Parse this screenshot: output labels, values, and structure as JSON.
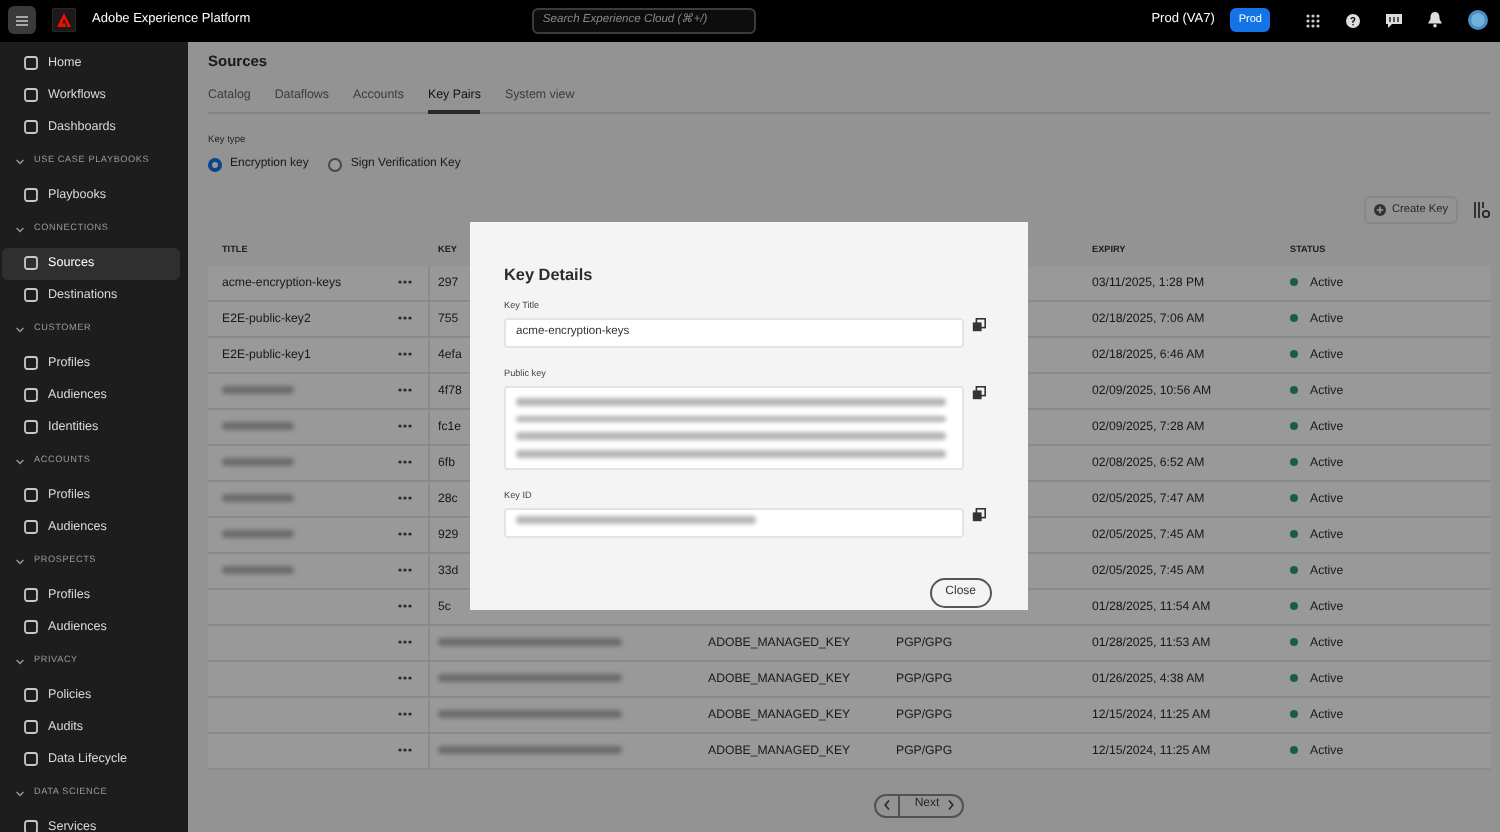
{
  "header": {
    "app_title": "Adobe Experience Platform",
    "search_placeholder": "Search Experience Cloud (⌘+/)",
    "org": "Prod (VA7)",
    "sandbox": "Prod"
  },
  "sidebar": {
    "items": [
      {
        "label": "Home",
        "selected": false
      },
      {
        "label": "Workflows",
        "selected": false
      },
      {
        "label": "Dashboards",
        "selected": false
      }
    ],
    "sections": [
      {
        "title": "USE CASE PLAYBOOKS",
        "expanded": true,
        "items": [
          {
            "label": "Playbooks",
            "selected": false
          }
        ]
      },
      {
        "title": "CONNECTIONS",
        "expanded": true,
        "items": [
          {
            "label": "Sources",
            "selected": true
          },
          {
            "label": "Destinations",
            "selected": false
          }
        ]
      },
      {
        "title": "CUSTOMER",
        "expanded": true,
        "items": [
          {
            "label": "Profiles",
            "selected": false
          },
          {
            "label": "Audiences",
            "selected": false
          },
          {
            "label": "Identities",
            "selected": false
          }
        ]
      },
      {
        "title": "ACCOUNTS",
        "expanded": true,
        "items": [
          {
            "label": "Profiles",
            "selected": false
          },
          {
            "label": "Audiences",
            "selected": false
          }
        ]
      },
      {
        "title": "PROSPECTS",
        "expanded": true,
        "items": [
          {
            "label": "Profiles",
            "selected": false
          },
          {
            "label": "Audiences",
            "selected": false
          }
        ]
      },
      {
        "title": "PRIVACY",
        "expanded": true,
        "items": [
          {
            "label": "Policies",
            "selected": false
          },
          {
            "label": "Audits",
            "selected": false
          },
          {
            "label": "Data Lifecycle",
            "selected": false
          }
        ]
      },
      {
        "title": "DATA SCIENCE",
        "expanded": true,
        "items": [
          {
            "label": "Services",
            "selected": false
          }
        ]
      }
    ]
  },
  "page": {
    "title": "Sources",
    "tabs": [
      {
        "label": "Catalog",
        "selected": false
      },
      {
        "label": "Dataflows",
        "selected": false
      },
      {
        "label": "Accounts",
        "selected": false
      },
      {
        "label": "Key Pairs",
        "selected": true
      },
      {
        "label": "System view",
        "selected": false
      }
    ],
    "key_type": {
      "label": "Key type",
      "options": [
        {
          "label": "Encryption key",
          "selected": true
        },
        {
          "label": "Sign Verification Key",
          "selected": false
        }
      ]
    },
    "create_button": "Create Key",
    "table": {
      "headers": {
        "title": "TITLE",
        "key_id": "KEY",
        "expiry": "EXPIRY",
        "status": "STATUS"
      },
      "rows": [
        {
          "title": "acme-encryption-keys",
          "key_id": "297",
          "expiry": "03/11/2025, 1:28 PM",
          "status": "Active"
        },
        {
          "title": "E2E-public-key2",
          "key_id": "755",
          "expiry": "02/18/2025, 7:06 AM",
          "status": "Active"
        },
        {
          "title": "E2E-public-key1",
          "key_id": "4efa",
          "expiry": "02/18/2025, 6:46 AM",
          "status": "Active"
        },
        {
          "title_redacted": true,
          "key_id": "4f78",
          "expiry": "02/09/2025, 10:56 AM",
          "status": "Active"
        },
        {
          "title_redacted": true,
          "key_id": "fc1e",
          "expiry": "02/09/2025, 7:28 AM",
          "status": "Active"
        },
        {
          "title_redacted": true,
          "key_id": "6fb",
          "expiry": "02/08/2025, 6:52 AM",
          "status": "Active"
        },
        {
          "title_redacted": true,
          "key_id": "28c",
          "expiry": "02/05/2025, 7:47 AM",
          "status": "Active"
        },
        {
          "title_redacted": true,
          "key_id": "929",
          "expiry": "02/05/2025, 7:45 AM",
          "status": "Active"
        },
        {
          "title_redacted": true,
          "key_id": "33d",
          "expiry": "02/05/2025, 7:45 AM",
          "status": "Active"
        },
        {
          "key_id": "5c",
          "expiry": "01/28/2025, 11:54 AM",
          "status": "Active"
        },
        {
          "key_id_redacted": true,
          "column_3": "ADOBE_MANAGED_KEY",
          "column_4": "PGP/GPG",
          "expiry": "01/28/2025, 11:53 AM",
          "status": "Active"
        },
        {
          "key_id_redacted": true,
          "column_3": "ADOBE_MANAGED_KEY",
          "column_4": "PGP/GPG",
          "expiry": "01/26/2025, 4:38 AM",
          "status": "Active"
        },
        {
          "key_id_redacted": true,
          "column_3": "ADOBE_MANAGED_KEY",
          "column_4": "PGP/GPG",
          "expiry": "12/15/2024, 11:25 AM",
          "status": "Active"
        },
        {
          "key_id_redacted": true,
          "column_3": "ADOBE_MANAGED_KEY",
          "column_4": "PGP/GPG",
          "expiry": "12/15/2024, 11:25 AM",
          "status": "Active"
        }
      ]
    },
    "pagination": {
      "next": "Next"
    }
  },
  "modal": {
    "title": "Key Details",
    "fields": [
      {
        "kind": "input",
        "label": "Key Title",
        "value": "acme-encryption-keys"
      },
      {
        "kind": "textarea",
        "label": "Public key",
        "redacted": true
      },
      {
        "kind": "input",
        "label": "Key ID",
        "redacted": true
      }
    ],
    "close": "Close"
  }
}
